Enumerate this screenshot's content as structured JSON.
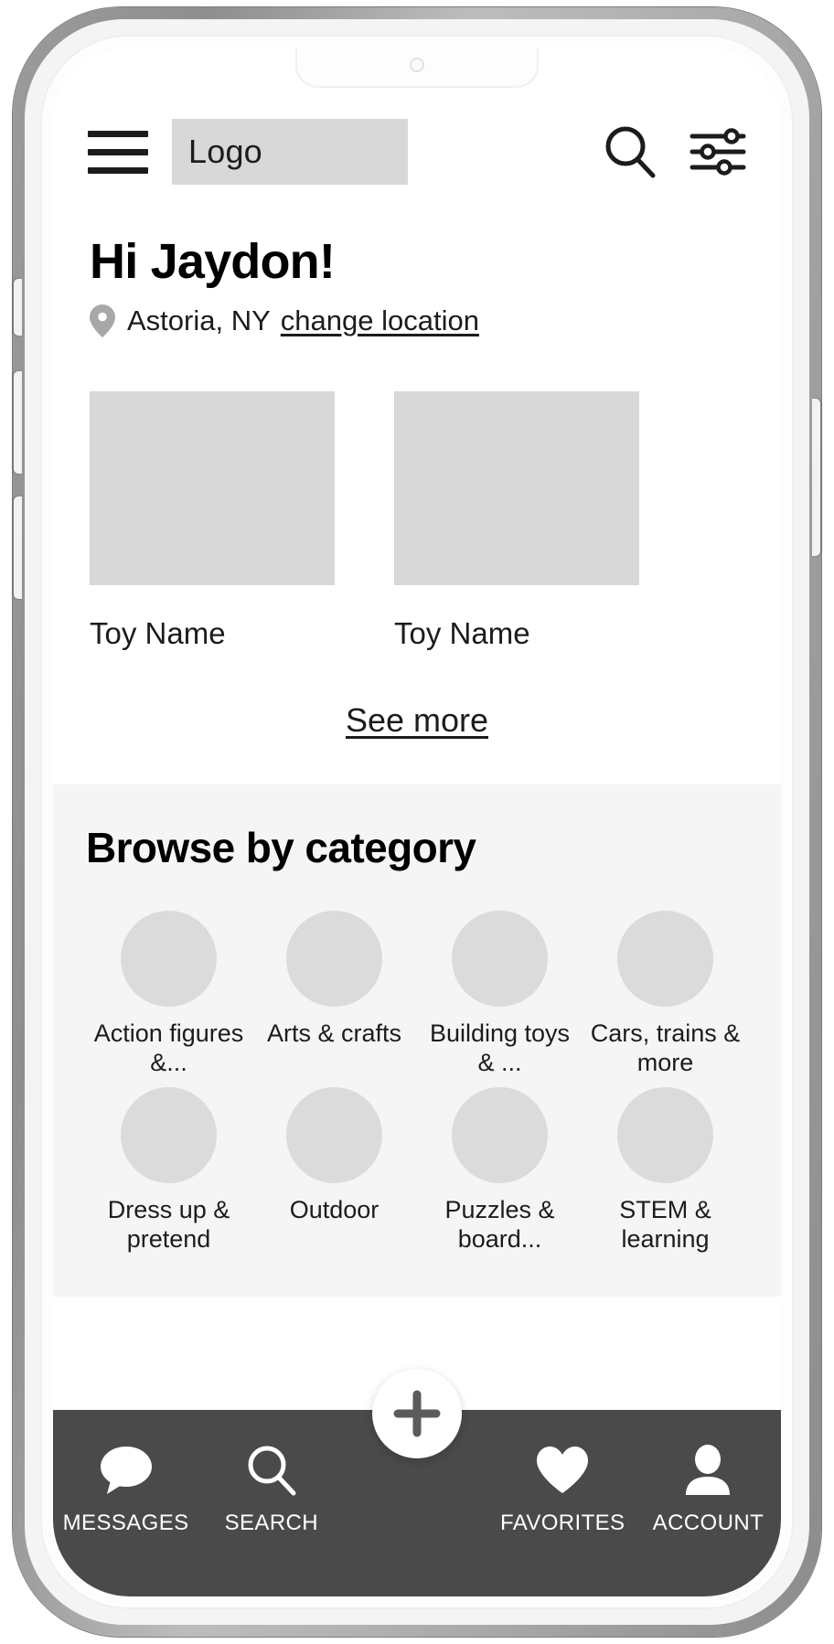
{
  "header": {
    "menu_icon": "hamburger-menu-icon",
    "logo_text": "Logo",
    "search_icon": "search-icon",
    "filter_icon": "filter-sliders-icon"
  },
  "greeting": {
    "title": "Hi Jaydon!",
    "pin_icon": "map-pin-icon",
    "location": "Astoria, NY",
    "change_location_label": "change location"
  },
  "featured": {
    "cards": [
      {
        "label": "Toy Name"
      },
      {
        "label": "Toy Name"
      }
    ],
    "see_more_label": "See more"
  },
  "categories": {
    "heading": "Browse by category",
    "items": [
      {
        "label": "Action figures &..."
      },
      {
        "label": "Arts & crafts"
      },
      {
        "label": "Building toys & ..."
      },
      {
        "label": "Cars, trains & more"
      },
      {
        "label": "Dress up & pretend"
      },
      {
        "label": "Outdoor"
      },
      {
        "label": "Puzzles & board..."
      },
      {
        "label": "STEM & learning"
      }
    ]
  },
  "fab": {
    "icon": "plus-icon"
  },
  "bottom_nav": {
    "items": [
      {
        "label": "MESSAGES",
        "icon": "chat-bubble-icon"
      },
      {
        "label": "SEARCH",
        "icon": "search-icon"
      },
      {
        "label": "FAVORITES",
        "icon": "heart-icon"
      },
      {
        "label": "ACCOUNT",
        "icon": "person-icon"
      }
    ]
  },
  "colors": {
    "placeholder_gray": "#d8d8d8",
    "section_bg": "#f5f5f5",
    "nav_bg": "#4a4a4a",
    "text": "#1c1c1c"
  }
}
